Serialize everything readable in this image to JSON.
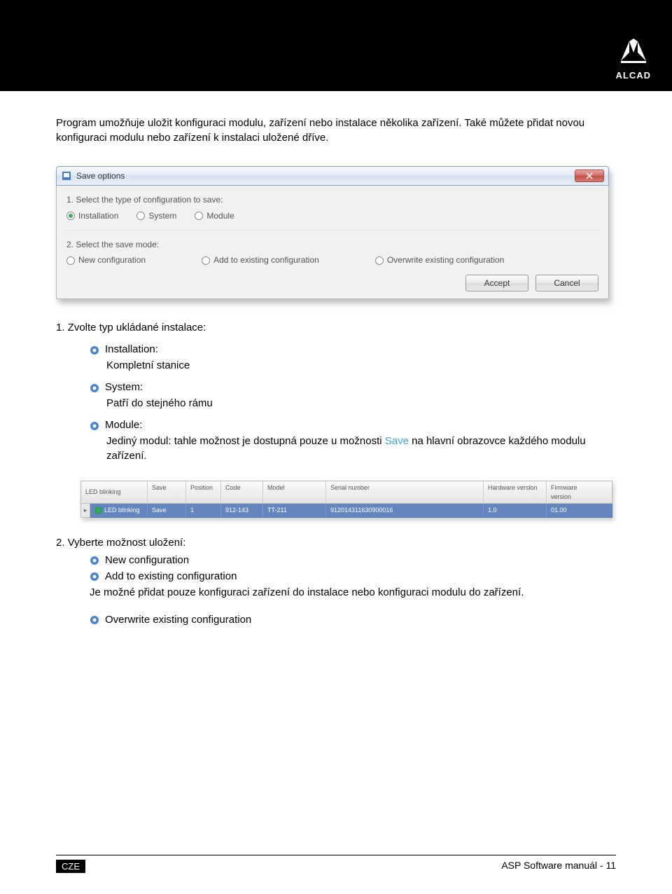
{
  "header": {
    "logo_text": "ALCAD"
  },
  "intro": "Program umožňuje uložit konfiguraci modulu, zařízení nebo instalace několika zařízení. Také můžete přidat novou konfiguraci modulu nebo zařízení k instalaci uložené dříve.",
  "dialog": {
    "title": "Save options",
    "section1_label": "1. Select the type of configuration to save:",
    "type_options": {
      "installation": "Installation",
      "system": "System",
      "module": "Module"
    },
    "section2_label": "2. Select the save mode:",
    "mode_options": {
      "new": "New configuration",
      "add": "Add to existing configuration",
      "overwrite": "Overwrite existing configuration"
    },
    "buttons": {
      "accept": "Accept",
      "cancel": "Cancel"
    }
  },
  "section1": {
    "heading": "1. Zvolte typ ukládané instalace:",
    "items": [
      {
        "label": "Installation:",
        "desc": "Kompletní stanice"
      },
      {
        "label": "System:",
        "desc": "Patří do stejného rámu"
      },
      {
        "label": "Module:",
        "desc_pre": "Jediný modul: tahle možnost je dostupná pouze u možnosti ",
        "desc_link": "Save",
        "desc_post": " na hlavní obrazovce každého modulu zařízení."
      }
    ]
  },
  "table": {
    "headers": {
      "led": "LED blinking",
      "save": "Save",
      "position": "Position",
      "code": "Code",
      "model": "Model",
      "serial": "Serial number",
      "hw": "Hardware version",
      "fw": "Firmware version"
    },
    "row": {
      "led": "LED blinking",
      "save": "Save",
      "position": "1",
      "code": "912-143",
      "model": "TT-211",
      "serial": "912014311630900016",
      "hw": "1.0",
      "fw": "01.00"
    }
  },
  "section2": {
    "heading": "2. Vyberte možnost uložení:",
    "item1": "New configuration",
    "item2": "Add to existing configuration",
    "item2_desc": "Je možné přidat pouze konfiguraci zařízení do instalace nebo konfiguraci modulu do zařízení.",
    "item3": "Overwrite existing configuration"
  },
  "footer": {
    "badge": "CZE",
    "page": "ASP Software manuál - 11"
  }
}
